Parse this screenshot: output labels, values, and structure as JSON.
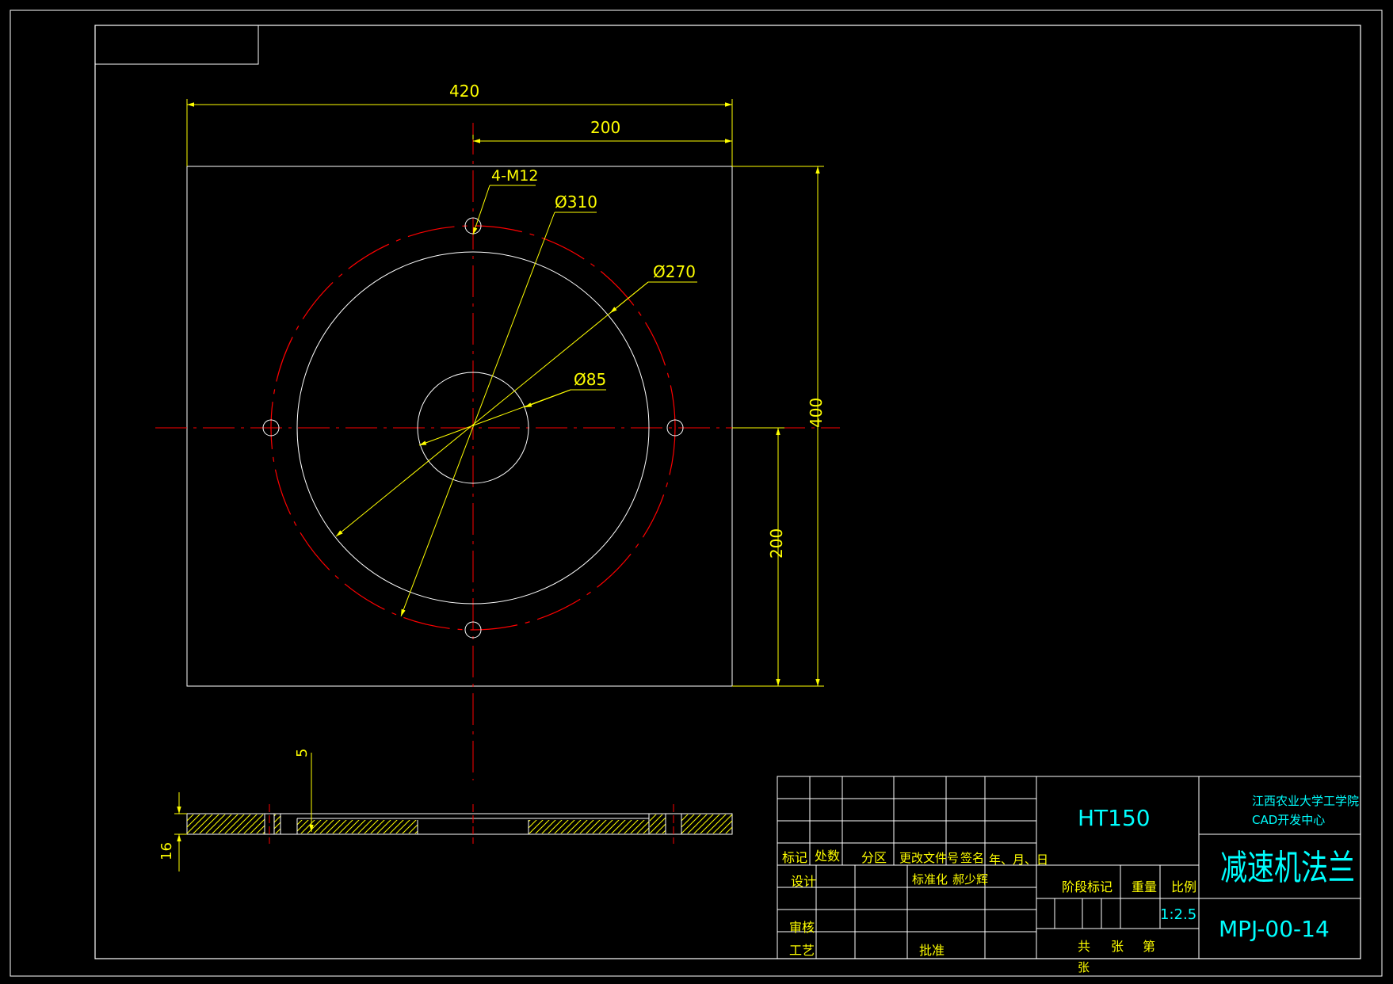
{
  "colors": {
    "background": "#000000",
    "outline": "#ffffff",
    "dimension": "#ffff00",
    "centerline": "#ff0000",
    "title_text": "#00ffff",
    "hatch": "#ffff00"
  },
  "dimensions": {
    "overall_width": "420",
    "half_width": "200",
    "hole_note": "4-M12",
    "dia_bolt_circle": "Ø310",
    "dia_recess": "Ø270",
    "dia_center": "Ø85",
    "overall_height": "400",
    "half_height": "200",
    "recess_depth": "5",
    "thickness": "16"
  },
  "title_block": {
    "material": "HT150",
    "school_line1": "江西农业大学工学院",
    "school_line2": "CAD开发中心",
    "part_name": "减速机法兰",
    "drawing_no": "MPJ-00-14",
    "scale_value": "1:2.5",
    "headers": {
      "mark": "标记",
      "count": "处数",
      "zone": "分区",
      "change_doc": "更改文件号",
      "signature": "签名",
      "date": "年、月、日",
      "design": "设计",
      "standardize": "标准化",
      "designer": "郝少辉",
      "review": "审核",
      "process": "工艺",
      "approve": "批准",
      "stage_mark": "阶段标记",
      "weight": "重量",
      "scale": "比例",
      "total": "共",
      "sheets": "张",
      "sheet_no": "第",
      "sheet_word": "张"
    }
  }
}
